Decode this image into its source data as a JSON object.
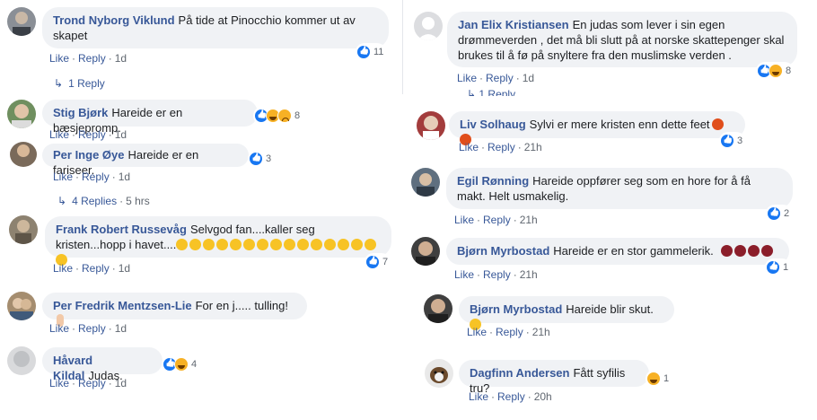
{
  "left_column": [
    {
      "author": "Trond Nyborg Viklund",
      "text": "På tide at Pinocchio kommer ut av skapet",
      "like": "Like",
      "reply": "Reply",
      "ago": "1d",
      "reaction_count": "11",
      "replies_label": "1 Reply"
    },
    {
      "author": "Stig Bjørk",
      "text": "Hareide er en bæsjepromp.",
      "like": "Like",
      "reply": "Reply",
      "ago": "1d",
      "reaction_count": "8"
    },
    {
      "author": "Per Inge Øye",
      "text": "Hareide er en fariseer.",
      "like": "Like",
      "reply": "Reply",
      "ago": "1d",
      "reaction_count": "3",
      "replies_label": "4 Replies",
      "replies_ago": "5 hrs"
    },
    {
      "author": "Frank Robert Russevåg",
      "text": "Selvgod fan....kaller seg kristen...hopp i havet....",
      "like": "Like",
      "reply": "Reply",
      "ago": "1d",
      "reaction_count": "7"
    },
    {
      "author": "Per Fredrik Mentzsen-Lie",
      "text": "For en j..... tulling!",
      "like": "Like",
      "reply": "Reply",
      "ago": "1d"
    },
    {
      "author": "Håvard Kildal",
      "text": "Judas.",
      "like": "Like",
      "reply": "Reply",
      "ago": "1d",
      "reaction_count": "4"
    }
  ],
  "right_column": [
    {
      "author": "Jan Elix Kristiansen",
      "text": "En judas som lever i sin egen drømmeverden , det må bli slutt på at norske skattepenger skal brukes til å fø på snyltere fra den muslimske verden .",
      "like": "Like",
      "reply": "Reply",
      "ago": "1d",
      "reaction_count": "8",
      "partial_reply": "1 Reply"
    },
    {
      "author": "Liv Solhaug",
      "text": "Sylvi er mere kristen enn dette feet",
      "like": "Like",
      "reply": "Reply",
      "ago": "21h",
      "reaction_count": "3"
    },
    {
      "author": "Egil Rønning",
      "text": "Hareide oppfører seg som en hore for å få makt. Helt usmakelig.",
      "like": "Like",
      "reply": "Reply",
      "ago": "21h",
      "reaction_count": "2"
    },
    {
      "author": "Bjørn Myrbostad",
      "text": "Hareide er en stor gammelerik.",
      "like": "Like",
      "reply": "Reply",
      "ago": "21h",
      "reaction_count": "1"
    },
    {
      "author": "Bjørn Myrbostad",
      "text": "Hareide blir skut.",
      "like": "Like",
      "reply": "Reply",
      "ago": "21h"
    },
    {
      "author": "Dagfinn Andersen",
      "text": "Fått syfilis tru?",
      "like": "Like",
      "reply": "Reply",
      "ago": "20h",
      "reaction_count": "1"
    }
  ]
}
